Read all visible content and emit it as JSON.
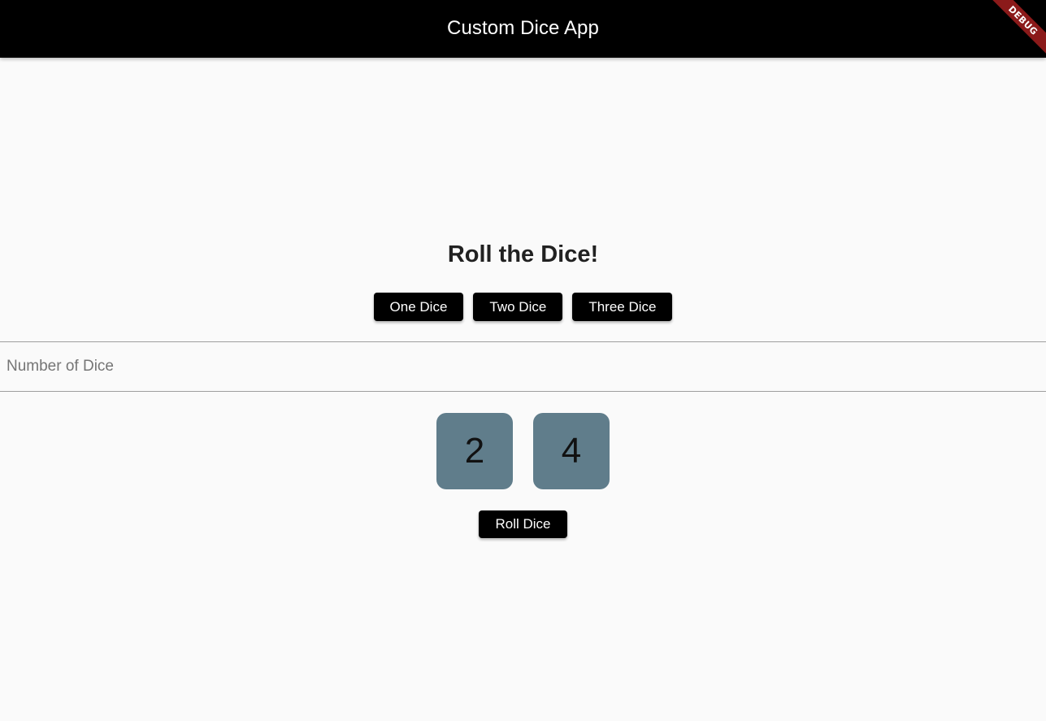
{
  "app_bar": {
    "title": "Custom Dice App",
    "background": "#000000"
  },
  "debug_banner": {
    "label": "DEBUG",
    "color": "#8b1a1a"
  },
  "main": {
    "heading": "Roll the Dice!",
    "preset_buttons": [
      {
        "label": "One Dice"
      },
      {
        "label": "Two Dice"
      },
      {
        "label": "Three Dice"
      }
    ],
    "dice_count_field": {
      "value": "",
      "placeholder": "Number of Dice"
    },
    "dice": [
      {
        "value": "2"
      },
      {
        "value": "4"
      }
    ],
    "dice_color": "#607d8b",
    "roll_button": {
      "label": "Roll Dice"
    }
  }
}
